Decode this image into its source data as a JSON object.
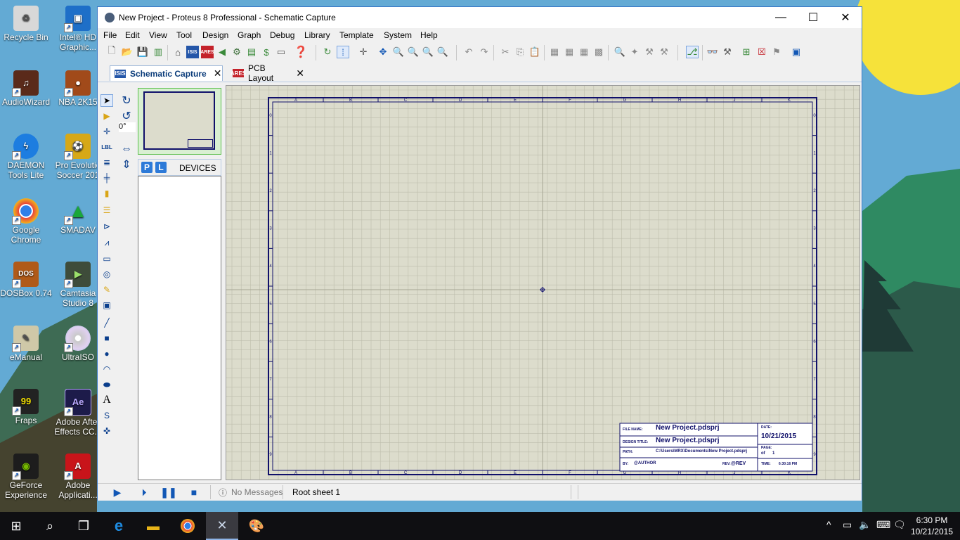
{
  "window": {
    "title": "New Project - Proteus 8 Professional - Schematic Capture",
    "minimize": "—",
    "maximize": "☐",
    "close": "✕"
  },
  "menu": [
    "File",
    "Edit",
    "View",
    "Tool",
    "Design",
    "Graph",
    "Debug",
    "Library",
    "Template",
    "System",
    "Help"
  ],
  "tabs": [
    {
      "label": "Schematic Capture",
      "icon": "ISIS",
      "close": "✕"
    },
    {
      "label": "PCB Layout",
      "icon": "ARES",
      "close": "✕"
    }
  ],
  "rotation": "0°",
  "devices": {
    "p": "P",
    "l": "L",
    "label": "DEVICES"
  },
  "sheet": {
    "columns": [
      "A",
      "B",
      "C",
      "D",
      "E",
      "F",
      "G",
      "H",
      "J",
      "K"
    ],
    "rows": [
      "0",
      "1",
      "2",
      "3",
      "4",
      "5",
      "6",
      "7",
      "8",
      "9"
    ],
    "title_block": {
      "file_name_label": "FILE NAME:",
      "file_name": "New Project.pdsprj",
      "design_title_label": "DESIGN TITLE:",
      "design_title": "New Project.pdsprj",
      "path_label": "PATH:",
      "path": "C:\\Users\\MRX\\Documents\\New Project.pdsprj",
      "by_label": "BY:",
      "by": "@AUTHOR",
      "rev_label": "REV:",
      "rev": "@REV",
      "date_label": "DATE:",
      "date": "10/21/2015",
      "page_label": "PAGE:",
      "page": "1",
      "of": "of",
      "total": "1",
      "time_label": "TIME:",
      "time": "6:30:16 PM"
    }
  },
  "status": {
    "messages": "No Messages",
    "sheet": "Root sheet 1"
  },
  "desktop_icons": [
    {
      "label": "Recycle Bin",
      "color": "#d8d8d8"
    },
    {
      "label": "Intel® HD Graphic...",
      "color": "#1e6fc8"
    },
    {
      "label": "AudioWizard",
      "color": "#5a2a1a"
    },
    {
      "label": "NBA 2K15",
      "color": "#a14a1a"
    },
    {
      "label": "DAEMON Tools Lite",
      "color": "#1d7de0"
    },
    {
      "label": "Pro Evolutio Soccer 201",
      "color": "#d6a818"
    },
    {
      "label": "Google Chrome",
      "color": "#ffffff"
    },
    {
      "label": "SMADAV",
      "color": "#1aa73a"
    },
    {
      "label": "DOSBox 0.74",
      "color": "#b05a18"
    },
    {
      "label": "Camtasia Studio 8",
      "color": "#3e4c3a"
    },
    {
      "label": "eManual",
      "color": "#cfc8a8"
    },
    {
      "label": "UltraISO",
      "color": "#c9c9c9"
    },
    {
      "label": "Fraps",
      "color": "#222222"
    },
    {
      "label": "Adobe After Effects CC...",
      "color": "#1d1b4a"
    },
    {
      "label": "GeForce Experience",
      "color": "#1d1d1d"
    },
    {
      "label": "Adobe Applicati...",
      "color": "#c8141a"
    }
  ],
  "clock": {
    "time": "6:30 PM",
    "date": "10/21/2015"
  },
  "colors": {
    "sheet_bg": "#dcdccc",
    "border": "#10106a",
    "accent": "#1257b5"
  }
}
